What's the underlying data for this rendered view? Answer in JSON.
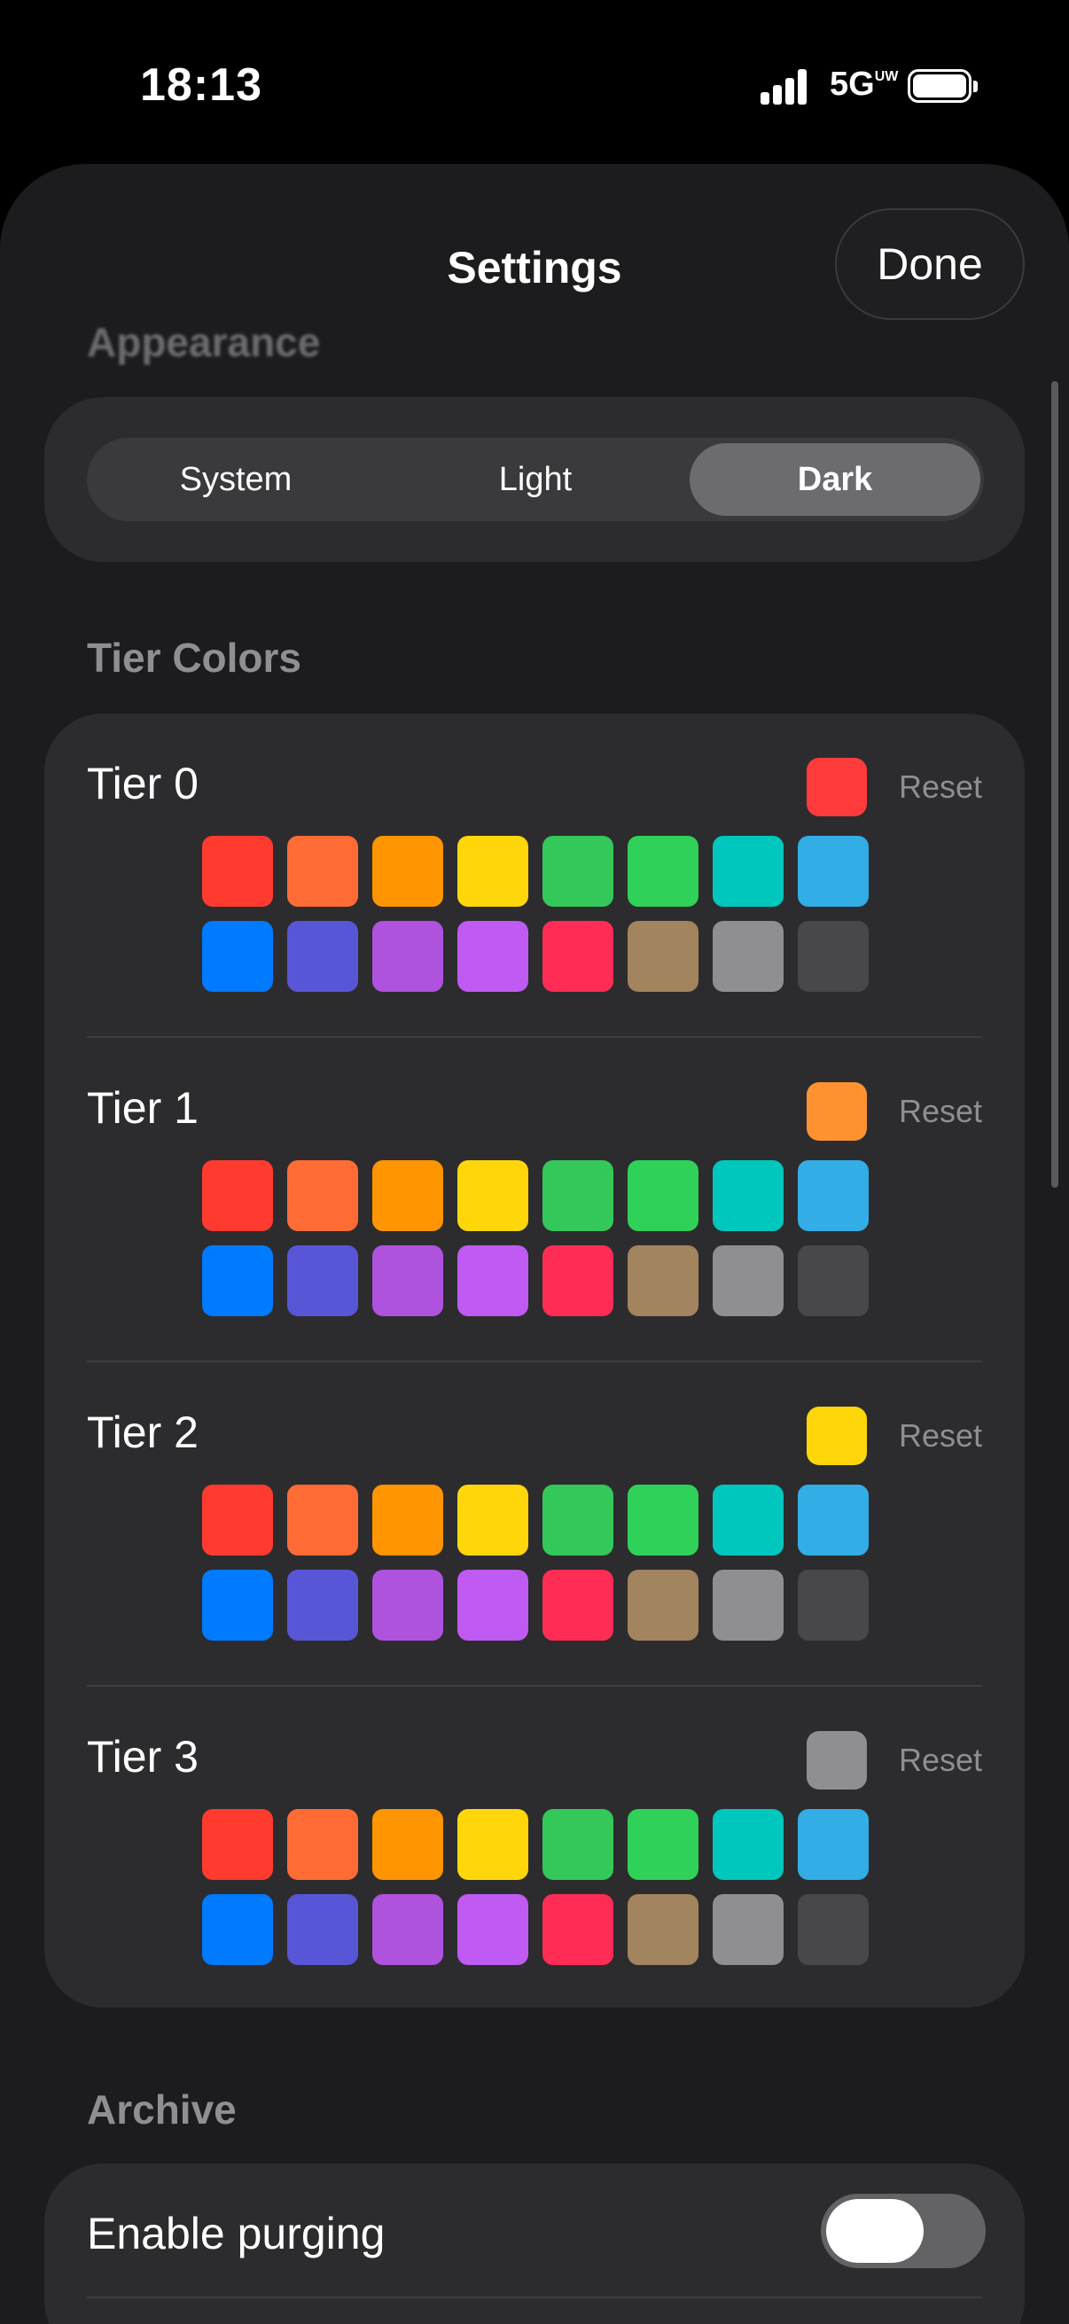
{
  "status": {
    "time": "18:13",
    "network": "5G",
    "network_sub": "UW"
  },
  "nav": {
    "title": "Settings",
    "done_label": "Done"
  },
  "appearance": {
    "header": "Appearance",
    "options": [
      "System",
      "Light",
      "Dark"
    ],
    "selected": "Dark"
  },
  "tier_colors": {
    "header": "Tier Colors",
    "reset_label": "Reset",
    "palette": [
      "#ff3b30",
      "#ff6b35",
      "#ff9500",
      "#ffd60a",
      "#34c759",
      "#30d158",
      "#00c7be",
      "#32ade6",
      "#007aff",
      "#5856d6",
      "#af52de",
      "#bf5af2",
      "#ff2d55",
      "#a2845e",
      "#8e8e93",
      "#48484a"
    ],
    "tiers": [
      {
        "label": "Tier 0",
        "color": "#ff3b3b"
      },
      {
        "label": "Tier 1",
        "color": "#ff9230"
      },
      {
        "label": "Tier 2",
        "color": "#ffd60a"
      },
      {
        "label": "Tier 3",
        "color": "#8e8e93"
      }
    ]
  },
  "archive": {
    "header": "Archive",
    "enable_purging_label": "Enable purging",
    "enable_purging": true
  }
}
